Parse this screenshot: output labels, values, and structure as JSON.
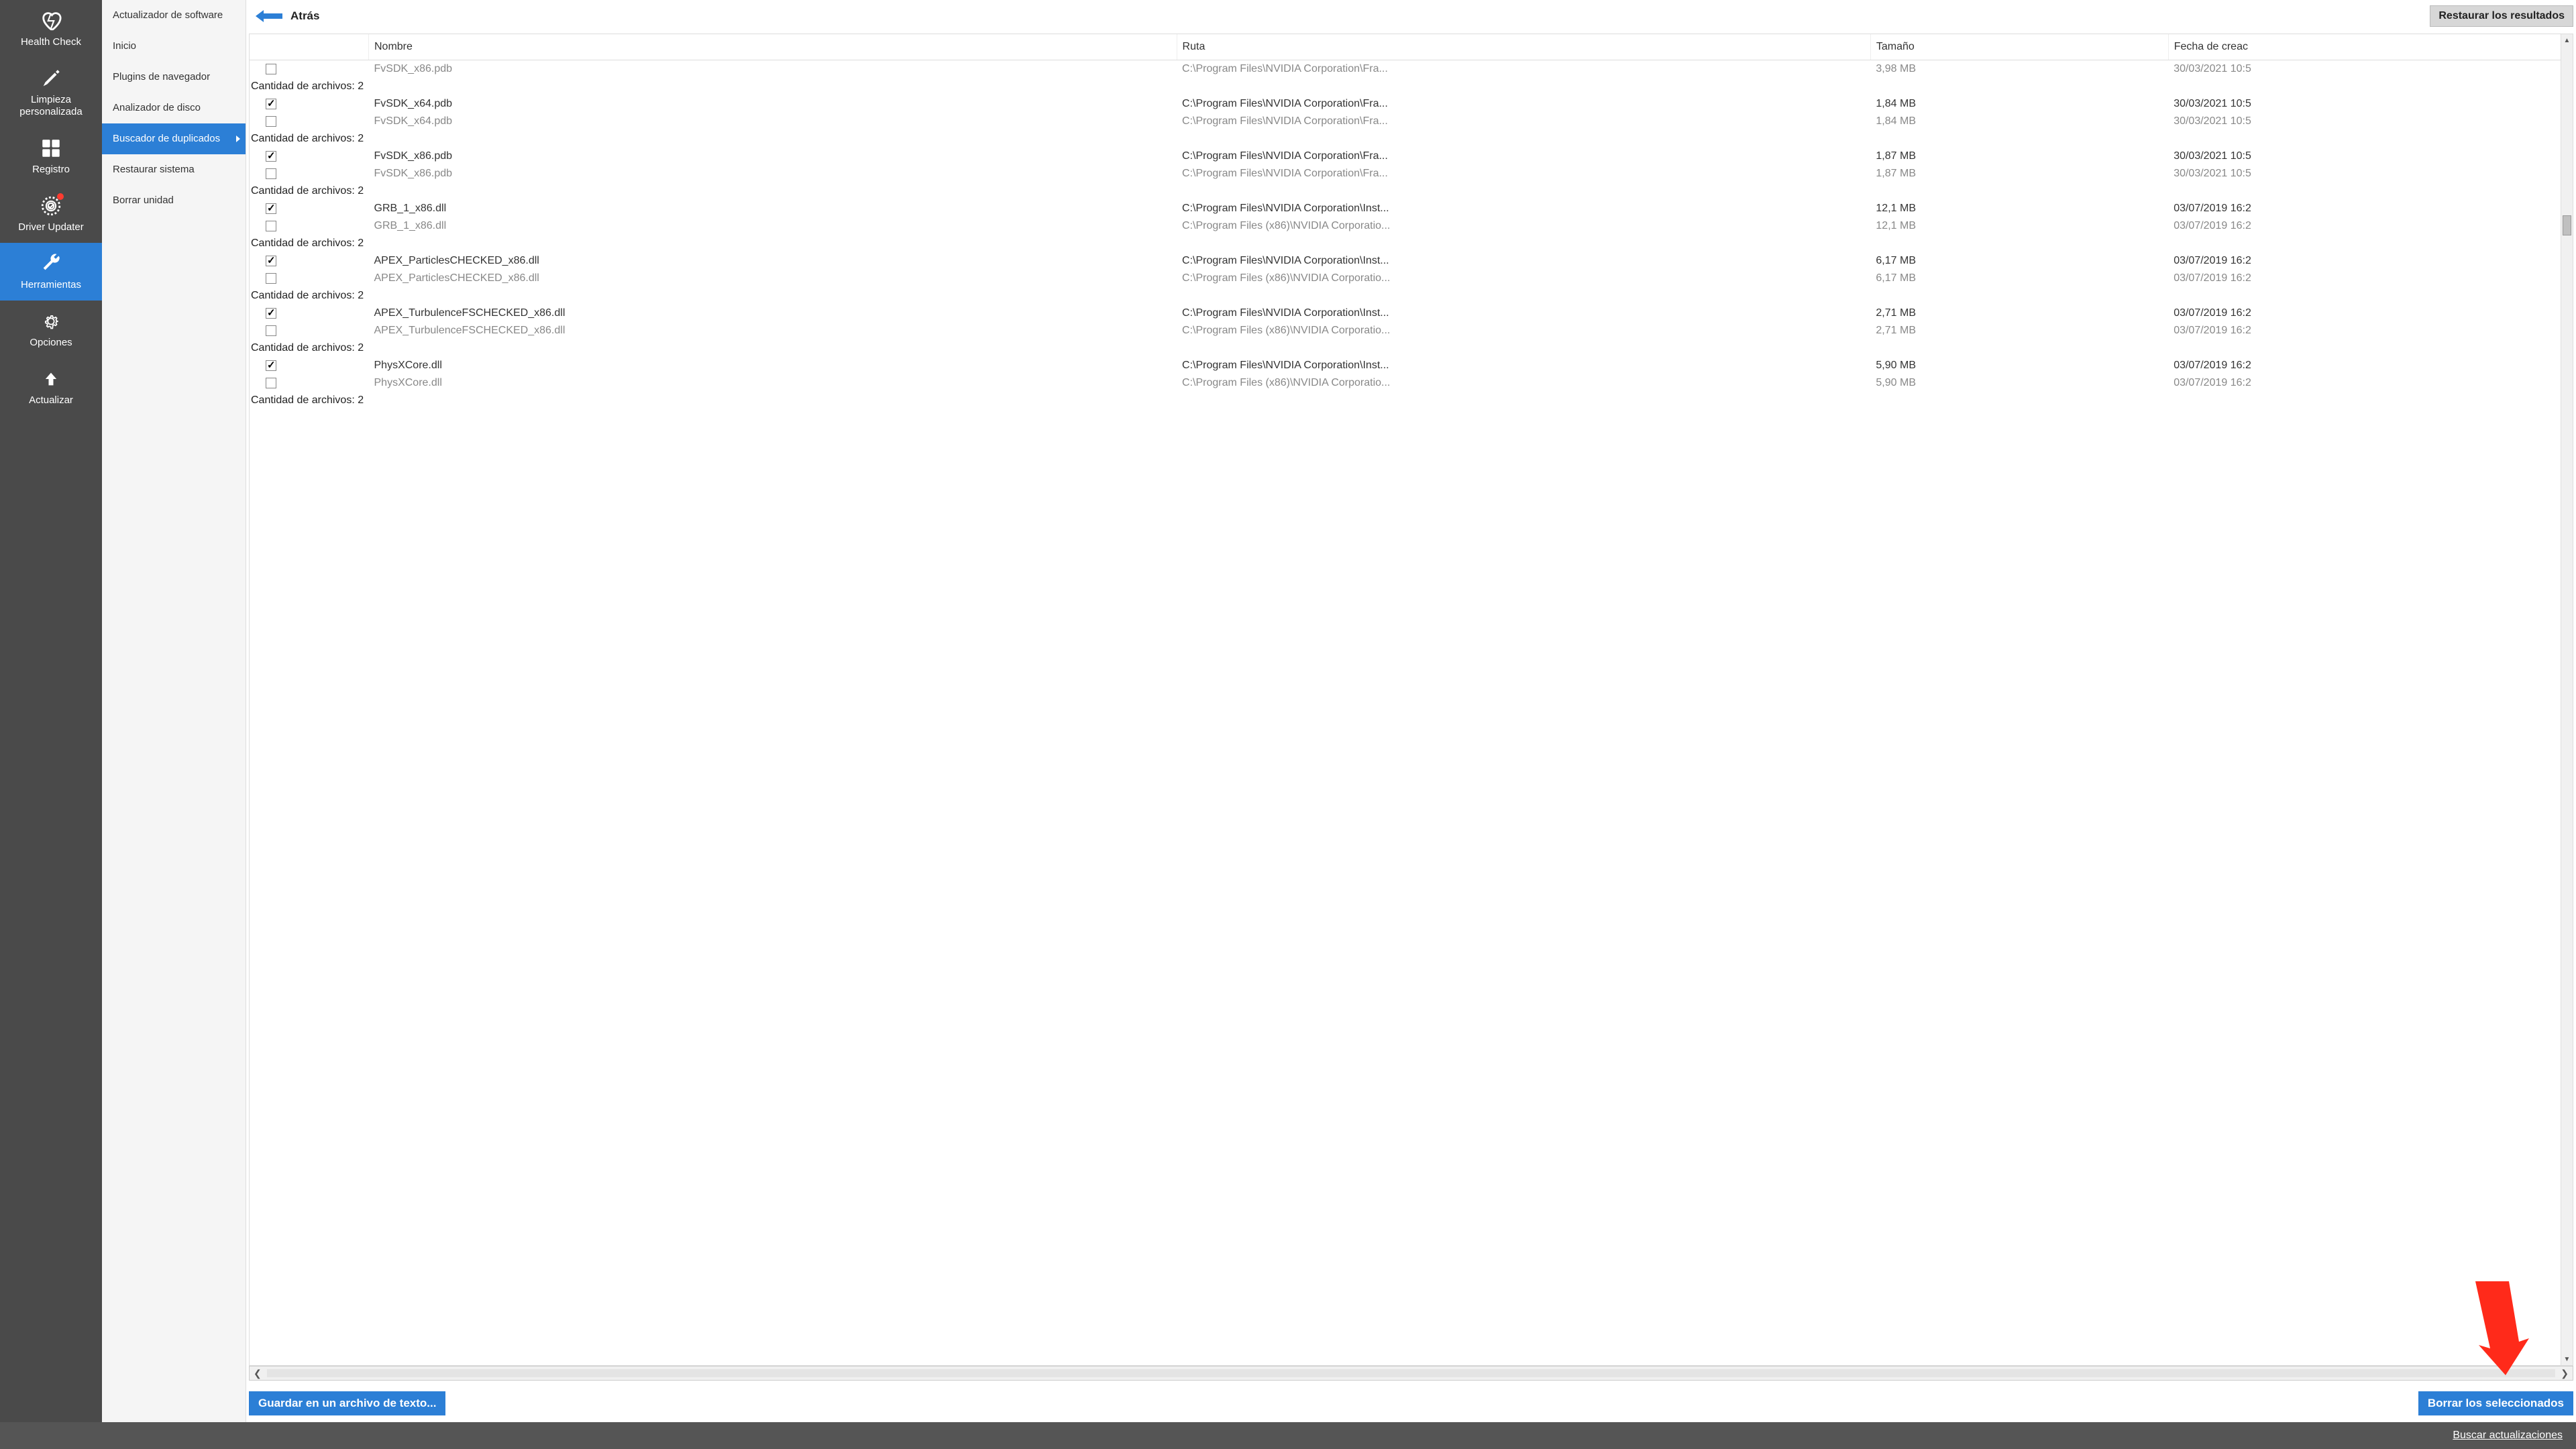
{
  "sidebar": {
    "items": [
      {
        "id": "health",
        "label": "Health Check"
      },
      {
        "id": "custom",
        "label": "Limpieza personalizada"
      },
      {
        "id": "registry",
        "label": "Registro"
      },
      {
        "id": "driver",
        "label": "Driver Updater"
      },
      {
        "id": "tools",
        "label": "Herramientas"
      },
      {
        "id": "options",
        "label": "Opciones"
      },
      {
        "id": "update",
        "label": "Actualizar"
      }
    ]
  },
  "sub": [
    {
      "label": "Actualizador de software"
    },
    {
      "label": "Inicio"
    },
    {
      "label": "Plugins de navegador"
    },
    {
      "label": "Analizador de disco"
    },
    {
      "label": "Buscador de duplicados",
      "active": true
    },
    {
      "label": "Restaurar sistema"
    },
    {
      "label": "Borrar unidad"
    }
  ],
  "topbar": {
    "back": "Atrás",
    "restore": "Restaurar los resultados"
  },
  "columns": {
    "name": "Nombre",
    "path": "Ruta",
    "size": "Tamaño",
    "date": "Fecha de creac"
  },
  "group_label": "Cantidad de archivos: 2",
  "rows": [
    {
      "chk": false,
      "dup": true,
      "name": "FvSDK_x86.pdb",
      "path": "C:\\Program Files\\NVIDIA Corporation\\Fra...",
      "size": "3,98 MB",
      "date": "30/03/2021 10:5"
    },
    {
      "group": true
    },
    {
      "chk": true,
      "name": "FvSDK_x64.pdb",
      "path": "C:\\Program Files\\NVIDIA Corporation\\Fra...",
      "size": "1,84 MB",
      "date": "30/03/2021 10:5"
    },
    {
      "chk": false,
      "dup": true,
      "name": "FvSDK_x64.pdb",
      "path": "C:\\Program Files\\NVIDIA Corporation\\Fra...",
      "size": "1,84 MB",
      "date": "30/03/2021 10:5"
    },
    {
      "group": true
    },
    {
      "chk": true,
      "name": "FvSDK_x86.pdb",
      "path": "C:\\Program Files\\NVIDIA Corporation\\Fra...",
      "size": "1,87 MB",
      "date": "30/03/2021 10:5"
    },
    {
      "chk": false,
      "dup": true,
      "name": "FvSDK_x86.pdb",
      "path": "C:\\Program Files\\NVIDIA Corporation\\Fra...",
      "size": "1,87 MB",
      "date": "30/03/2021 10:5"
    },
    {
      "group": true
    },
    {
      "chk": true,
      "name": "GRB_1_x86.dll",
      "path": "C:\\Program Files\\NVIDIA Corporation\\Inst...",
      "size": "12,1 MB",
      "date": "03/07/2019 16:2"
    },
    {
      "chk": false,
      "dup": true,
      "name": "GRB_1_x86.dll",
      "path": "C:\\Program Files (x86)\\NVIDIA Corporatio...",
      "size": "12,1 MB",
      "date": "03/07/2019 16:2"
    },
    {
      "group": true
    },
    {
      "chk": true,
      "name": "APEX_ParticlesCHECKED_x86.dll",
      "path": "C:\\Program Files\\NVIDIA Corporation\\Inst...",
      "size": "6,17 MB",
      "date": "03/07/2019 16:2"
    },
    {
      "chk": false,
      "dup": true,
      "name": "APEX_ParticlesCHECKED_x86.dll",
      "path": "C:\\Program Files (x86)\\NVIDIA Corporatio...",
      "size": "6,17 MB",
      "date": "03/07/2019 16:2"
    },
    {
      "group": true
    },
    {
      "chk": true,
      "name": "APEX_TurbulenceFSCHECKED_x86.dll",
      "path": "C:\\Program Files\\NVIDIA Corporation\\Inst...",
      "size": "2,71 MB",
      "date": "03/07/2019 16:2"
    },
    {
      "chk": false,
      "dup": true,
      "name": "APEX_TurbulenceFSCHECKED_x86.dll",
      "path": "C:\\Program Files (x86)\\NVIDIA Corporatio...",
      "size": "2,71 MB",
      "date": "03/07/2019 16:2"
    },
    {
      "group": true
    },
    {
      "chk": true,
      "name": "PhysXCore.dll",
      "path": "C:\\Program Files\\NVIDIA Corporation\\Inst...",
      "size": "5,90 MB",
      "date": "03/07/2019 16:2"
    },
    {
      "chk": false,
      "dup": true,
      "name": "PhysXCore.dll",
      "path": "C:\\Program Files (x86)\\NVIDIA Corporatio...",
      "size": "5,90 MB",
      "date": "03/07/2019 16:2"
    },
    {
      "group": true
    }
  ],
  "footer": {
    "save": "Guardar en un archivo de texto...",
    "delete": "Borrar los seleccionados"
  },
  "status": {
    "updates": "Buscar actualizaciones"
  }
}
